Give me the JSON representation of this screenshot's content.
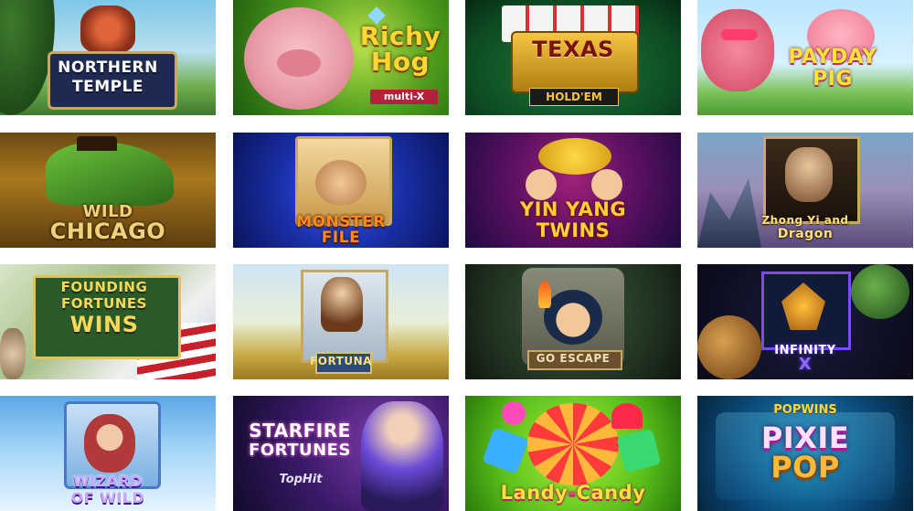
{
  "games": [
    {
      "line1": "NORTHERN",
      "line2": "TEMPLE",
      "sub": ""
    },
    {
      "line1": "Richy",
      "line2": "Hog",
      "sub": "multi-X"
    },
    {
      "line1": "TEXAS",
      "line2": "",
      "sub": "HOLD'EM"
    },
    {
      "line1": "PAYDAY",
      "line2": "PIG",
      "sub": ""
    },
    {
      "line1": "WILD",
      "line2": "CHICAGO",
      "sub": ""
    },
    {
      "line1": "MONSTER",
      "line2": "FILE",
      "sub": ""
    },
    {
      "line1": "YIN YANG",
      "line2": "TWINS",
      "sub": ""
    },
    {
      "line1": "Zhong Yi and",
      "line2": "Dragon",
      "sub": ""
    },
    {
      "line1": "FOUNDING",
      "line2": "FORTUNES",
      "line3": "WINS",
      "sub": ""
    },
    {
      "line1": "FORTUNA",
      "line2": "",
      "sub": ""
    },
    {
      "line1": "GO ESCAPE",
      "line2": "",
      "sub": ""
    },
    {
      "line1": "INFINITY",
      "line2": "X",
      "sub": ""
    },
    {
      "line1": "WIZARD",
      "line2": "OF WILD",
      "sub": ""
    },
    {
      "line1": "STARFIRE",
      "line2": "FORTUNES",
      "sub": "TopHit"
    },
    {
      "line1": "Landy",
      "line2": "Candy",
      "sub": ""
    },
    {
      "line1": "PIXIE",
      "line2": "POP",
      "sub": "POPWINS"
    }
  ]
}
